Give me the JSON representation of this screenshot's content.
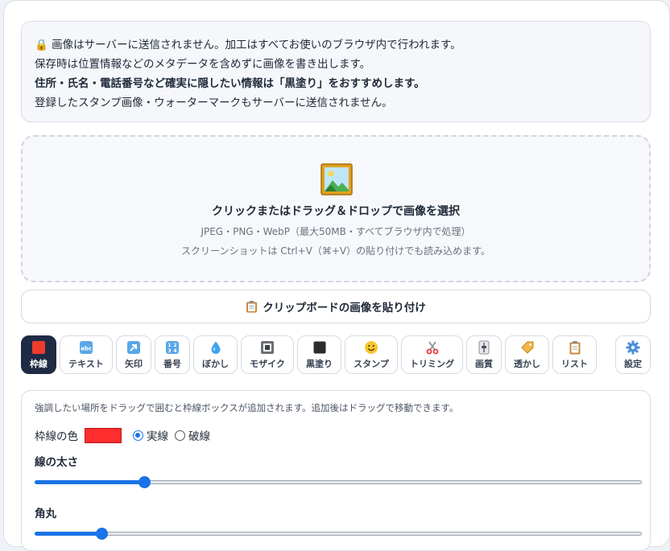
{
  "notice": {
    "lines": [
      "🔒 画像はサーバーに送信されません。加工はすべてお使いのブラウザ内で行われます。",
      "保存時は位置情報などのメタデータを含めずに画像を書き出します。",
      "住所・氏名・電話番号など確実に隠したい情報は「黒塗り」をおすすめします。",
      "登録したスタンプ画像・ウォーターマークもサーバーに送信されません。"
    ]
  },
  "dropzone": {
    "icon": "framed-picture-icon",
    "title": "クリックまたはドラッグ＆ドロップで画像を選択",
    "formats": "JPEG・PNG・WebP（最大50MB・すべてブラウザ内で処理）",
    "hint": "スクリーンショットは Ctrl+V（⌘+V）の貼り付けでも読み込めます。"
  },
  "paste_button": {
    "icon": "clipboard-icon",
    "label": "クリップボードの画像を貼り付け"
  },
  "toolbar": {
    "tools": [
      {
        "id": "frame",
        "label": "枠線",
        "icon": "red-square-icon",
        "active": true
      },
      {
        "id": "text",
        "label": "テキスト",
        "icon": "abc-icon",
        "active": false
      },
      {
        "id": "arrow",
        "label": "矢印",
        "icon": "arrow-up-right-icon",
        "active": false
      },
      {
        "id": "number",
        "label": "番号",
        "icon": "numbers-1234-icon",
        "active": false
      },
      {
        "id": "blur",
        "label": "ぼかし",
        "icon": "droplet-icon",
        "active": false
      },
      {
        "id": "mosaic",
        "label": "モザイク",
        "icon": "square-button-icon",
        "active": false
      },
      {
        "id": "blackout",
        "label": "黒塗り",
        "icon": "black-square-icon",
        "active": false
      },
      {
        "id": "stamp",
        "label": "スタンプ",
        "icon": "smiley-icon",
        "active": false
      },
      {
        "id": "trim",
        "label": "トリミング",
        "icon": "scissors-icon",
        "active": false
      },
      {
        "id": "quality",
        "label": "画質",
        "icon": "slider-control-icon",
        "active": false
      },
      {
        "id": "watermark",
        "label": "透かし",
        "icon": "tag-icon",
        "active": false
      },
      {
        "id": "list",
        "label": "リスト",
        "icon": "clipboard-list-icon",
        "active": false
      }
    ],
    "settings": {
      "label": "設定",
      "icon": "gear-icon"
    }
  },
  "panel": {
    "description": "強調したい場所をドラッグで囲むと枠線ボックスが追加されます。追加後はドラッグで移動できます。",
    "color_label": "枠線の色",
    "color_value": "#ff2d2d",
    "style_options": [
      {
        "label": "実線",
        "selected": true
      },
      {
        "label": "破線",
        "selected": false
      }
    ],
    "thickness_label": "線の太さ",
    "thickness_value": 0.18,
    "radius_label": "角丸",
    "radius_value": 0.11
  }
}
